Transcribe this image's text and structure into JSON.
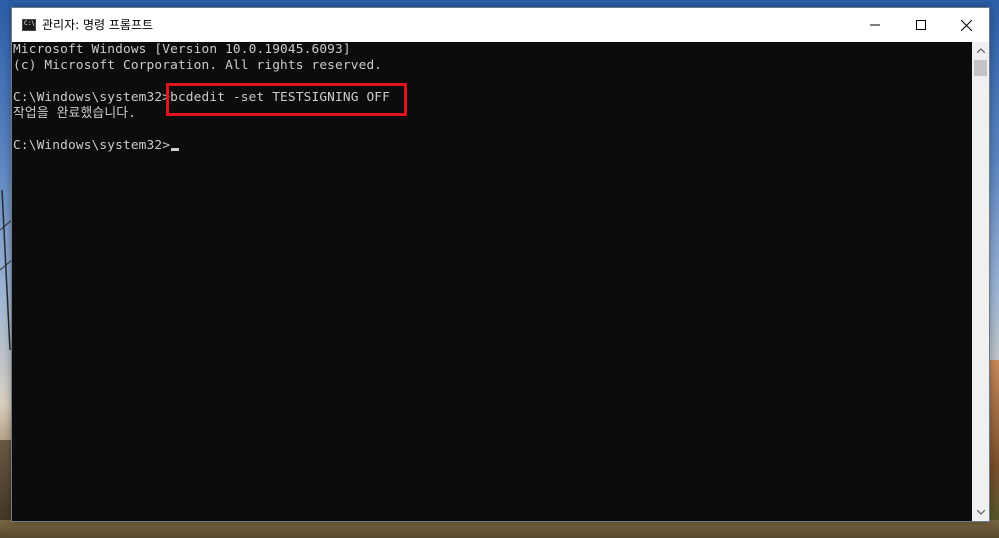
{
  "window": {
    "title": "관리자: 명령 프롬프트",
    "icon": "cmd-icon",
    "icon_text": "C:\\",
    "controls": [
      "minimize-icon",
      "maximize-icon",
      "close-icon"
    ]
  },
  "console": {
    "lines": [
      "Microsoft Windows [Version 10.0.19045.6093]",
      "(c) Microsoft Corporation. All rights reserved.",
      "C:\\Windows\\system32>bcdedit -set TESTSIGNING OFF",
      "작업을 완료했습니다.",
      "C:\\Windows\\system32>"
    ],
    "highlighted_command": "bcdedit -set TESTSIGNING OFF",
    "highlight_color": "#e0141d",
    "text_color": "#cccccc",
    "background_color": "#0c0c0c"
  },
  "scrollbar": {
    "up_icon": "scroll-up-arrow-icon",
    "down_icon": "scroll-down-arrow-icon"
  }
}
